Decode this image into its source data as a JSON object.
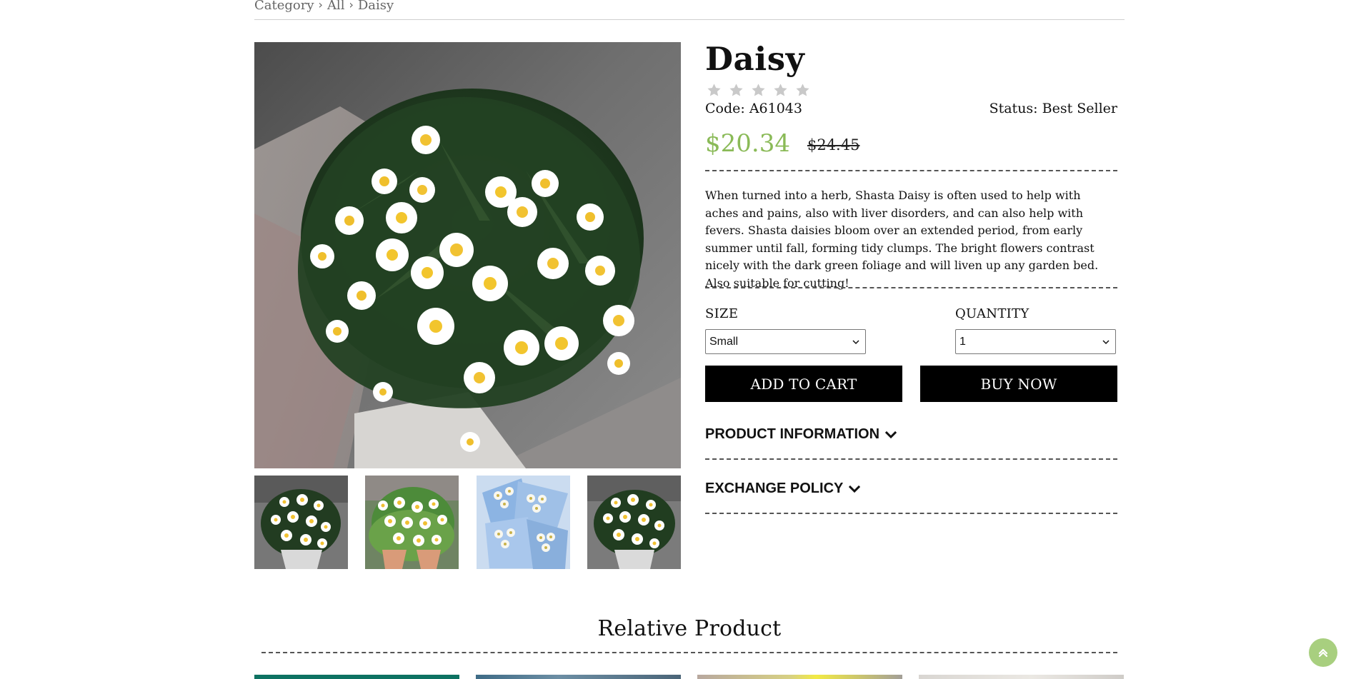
{
  "breadcrumb": {
    "items": [
      "Category",
      "All",
      "Daisy"
    ]
  },
  "product": {
    "name": "Daisy",
    "rating": 0,
    "rating_max": 5,
    "code_label": "Code: A61043",
    "status_label": "Status: Best Seller",
    "price_current": "$20.34",
    "price_old": "$24.45",
    "description": "When turned into a herb, Shasta Daisy is often used to help with aches and pains, also with liver disorders, and can also help with fevers. Shasta daisies bloom over an extended period, from early summer until fall, forming tidy clumps. The bright flowers contrast nicely with the dark green foliage and will liven up any garden bed. Also suitable for cutting!",
    "size_label": "SIZE",
    "size_selected": "Small",
    "quantity_label": "QUANTITY",
    "quantity_selected": "1",
    "add_to_cart_label": "ADD TO CART",
    "buy_now_label": "BUY NOW",
    "product_information_label": "PRODUCT INFORMATION",
    "exchange_policy_label": "EXCHANGE POLICY"
  },
  "related": {
    "title": "Relative Product"
  },
  "colors": {
    "price_green": "#8aba57",
    "button_black": "#000000",
    "back_to_top_green": "#a8cf7f",
    "star_gray": "#c9c9c9"
  },
  "icons": {
    "breadcrumb_separator": "chevron-right-icon",
    "accordion": "chevron-down-icon",
    "back_to_top": "double-chevron-up-icon",
    "star": "star-icon"
  }
}
